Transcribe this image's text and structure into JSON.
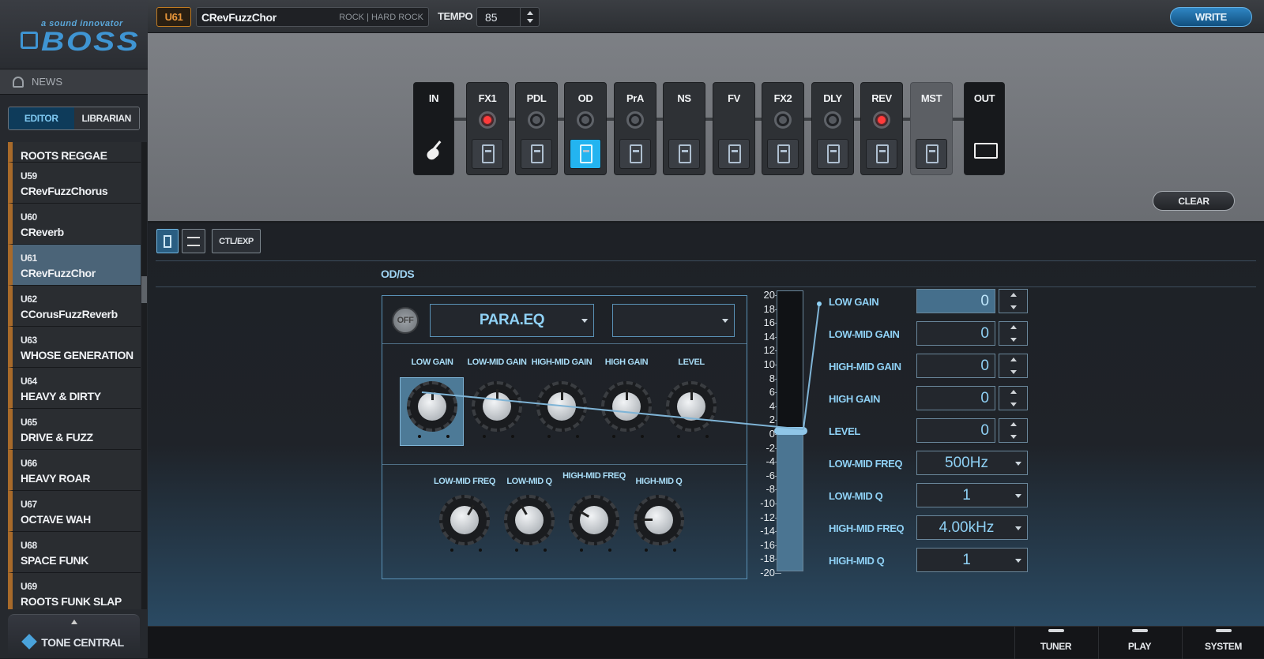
{
  "app": {
    "logo_tagline": "a sound innovator",
    "logo_brand": "BOSS",
    "news_label": "NEWS",
    "mode_tabs": [
      {
        "label": "EDITOR",
        "active": true
      },
      {
        "label": "LIBRARIAN",
        "active": false
      }
    ],
    "tone_central_label": "TONE CENTRAL"
  },
  "presets": [
    {
      "num": "",
      "name": "ROOTS REGGAE",
      "selected": false
    },
    {
      "num": "U59",
      "name": "CRevFuzzChorus",
      "selected": false
    },
    {
      "num": "U60",
      "name": "CReverb",
      "selected": false
    },
    {
      "num": "U61",
      "name": "CRevFuzzChor",
      "selected": true
    },
    {
      "num": "U62",
      "name": "CCorusFuzzReverb",
      "selected": false
    },
    {
      "num": "U63",
      "name": "WHOSE GENERATION",
      "selected": false
    },
    {
      "num": "U64",
      "name": "HEAVY & DIRTY",
      "selected": false
    },
    {
      "num": "U65",
      "name": "DRIVE & FUZZ",
      "selected": false
    },
    {
      "num": "U66",
      "name": "HEAVY ROAR",
      "selected": false
    },
    {
      "num": "U67",
      "name": "OCTAVE WAH",
      "selected": false
    },
    {
      "num": "U68",
      "name": "SPACE FUNK",
      "selected": false
    },
    {
      "num": "U69",
      "name": "ROOTS FUNK SLAP",
      "selected": false
    }
  ],
  "topbar": {
    "patch_number": "U61",
    "patch_name": "CRevFuzzChor",
    "patch_genre": "ROCK | HARD ROCK",
    "tempo_label": "TEMPO",
    "tempo_value": "85",
    "write_label": "WRITE"
  },
  "chain": {
    "blocks": [
      {
        "label": "IN",
        "type": "io"
      },
      {
        "label": "FX1",
        "led": "red",
        "pedal_on": false
      },
      {
        "label": "PDL",
        "led": "off",
        "pedal_on": false
      },
      {
        "label": "OD",
        "led": "off",
        "pedal_on": true
      },
      {
        "label": "PrA",
        "led": "off",
        "pedal_on": false
      },
      {
        "label": "NS",
        "led": "none",
        "pedal_on": false
      },
      {
        "label": "FV",
        "led": "none",
        "pedal_on": false
      },
      {
        "label": "FX2",
        "led": "off",
        "pedal_on": false
      },
      {
        "label": "DLY",
        "led": "off",
        "pedal_on": false
      },
      {
        "label": "REV",
        "led": "red",
        "pedal_on": false
      },
      {
        "label": "MST",
        "type": "mst"
      },
      {
        "label": "OUT",
        "type": "io"
      }
    ],
    "clear_label": "CLEAR"
  },
  "editor": {
    "ctl_exp_label": "CTL/EXP",
    "section_title": "OD/DS",
    "off_label": "OFF",
    "type_value": "PARA.EQ",
    "type2_value": "",
    "knobs_top": [
      {
        "label": "LOW GAIN",
        "selected": true
      },
      {
        "label": "LOW-MID GAIN",
        "selected": false
      },
      {
        "label": "HIGH-MID GAIN",
        "selected": false
      },
      {
        "label": "HIGH GAIN",
        "selected": false
      },
      {
        "label": "LEVEL",
        "selected": false
      }
    ],
    "knobs_bottom": [
      {
        "label": "LOW-MID FREQ"
      },
      {
        "label": "LOW-MID Q"
      },
      {
        "label": "HIGH-MID FREQ"
      },
      {
        "label": "HIGH-MID Q"
      }
    ],
    "fader": {
      "ticks": [
        "20",
        "18",
        "16",
        "14",
        "12",
        "10",
        "8",
        "6",
        "4",
        "2",
        "0",
        "-2",
        "-4",
        "-6",
        "-8",
        "-10",
        "-12",
        "-14",
        "-16",
        "-18",
        "-20"
      ],
      "value": 0,
      "min": -20,
      "max": 20
    },
    "params": [
      {
        "label": "LOW GAIN",
        "value": "0",
        "kind": "spin",
        "active": true
      },
      {
        "label": "LOW-MID GAIN",
        "value": "0",
        "kind": "spin",
        "active": false
      },
      {
        "label": "HIGH-MID GAIN",
        "value": "0",
        "kind": "spin",
        "active": false
      },
      {
        "label": "HIGH GAIN",
        "value": "0",
        "kind": "spin",
        "active": false
      },
      {
        "label": "LEVEL",
        "value": "0",
        "kind": "spin",
        "active": false
      },
      {
        "label": "LOW-MID FREQ",
        "value": "500Hz",
        "kind": "select",
        "active": false
      },
      {
        "label": "LOW-MID Q",
        "value": "1",
        "kind": "select",
        "active": false
      },
      {
        "label": "HIGH-MID FREQ",
        "value": "4.00kHz",
        "kind": "select",
        "active": false
      },
      {
        "label": "HIGH-MID Q",
        "value": "1",
        "kind": "select",
        "active": false
      }
    ]
  },
  "bottombar": {
    "buttons": [
      "TUNER",
      "PLAY",
      "SYSTEM"
    ]
  },
  "colors": {
    "accent": "#3f95d3",
    "text_blue": "#8fd1f5",
    "patch_orange": "#e8963a",
    "led_red": "#ff3b3b",
    "pedal_on": "#23b4f0"
  }
}
